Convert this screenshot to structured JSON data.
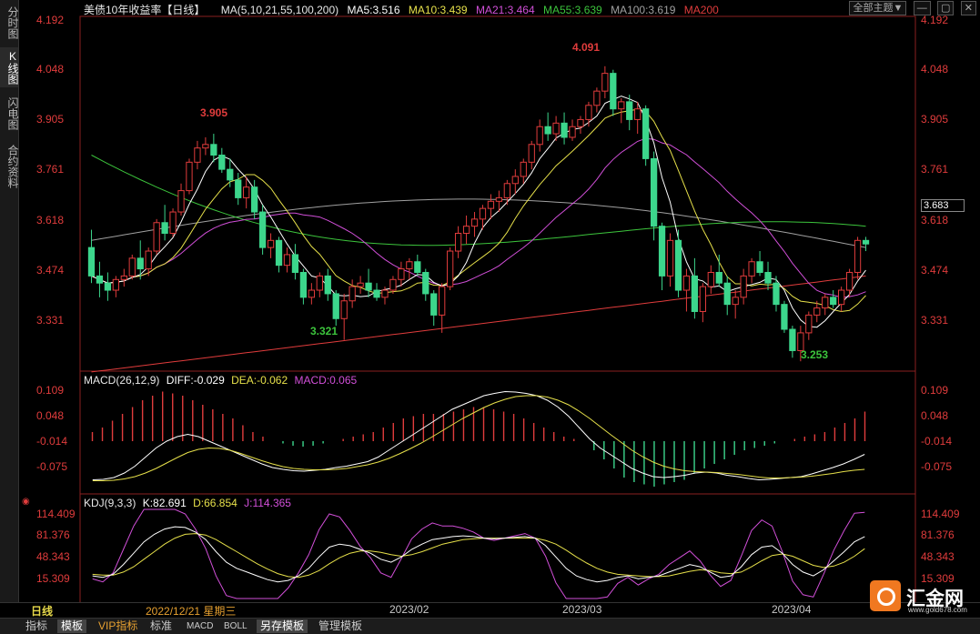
{
  "left_tabs": [
    {
      "label": "分时图",
      "active": false
    },
    {
      "label": "K线图",
      "active": true
    },
    {
      "label": "闪电图",
      "active": false
    },
    {
      "label": "合约资料",
      "active": false
    }
  ],
  "header": {
    "title": "美债10年收益率",
    "period": "【日线】",
    "ma_label": "MA(5,10,21,55,100,200)",
    "ma5": "MA5:3.516",
    "ma10": "MA10:3.439",
    "ma21": "MA21:3.464",
    "ma55": "MA55:3.639",
    "ma100": "MA100:3.619",
    "ma200": "MA200",
    "theme_btn": "全部主题▼",
    "colors": {
      "ma5": "#ffffff",
      "ma10": "#e6e04a",
      "ma21": "#d14fd8",
      "ma55": "#3cc43c",
      "ma100": "#a0a0a0",
      "ma200": "#e03c3c"
    }
  },
  "main_axis": {
    "ticks": [
      "4.192",
      "4.048",
      "3.905",
      "3.761",
      "3.618",
      "3.474",
      "3.331"
    ],
    "current_price": "3.683"
  },
  "annotations": {
    "high1": "3.905",
    "low1": "3.321",
    "high2": "4.091",
    "low2": "3.253"
  },
  "macd": {
    "title": "MACD(26,12,9)",
    "diff": "DIFF:-0.029",
    "dea": "DEA:-0.062",
    "macd": "MACD:0.065",
    "ticks": [
      "0.109",
      "0.048",
      "-0.014",
      "-0.075"
    ]
  },
  "kdj": {
    "title": "KDJ(9,3,3)",
    "k": "K:82.691",
    "d": "D:66.854",
    "j": "J:114.365",
    "ticks": [
      "114.409",
      "81.376",
      "48.343",
      "15.309"
    ]
  },
  "date_axis": {
    "period_label": "日线",
    "cursor_date": "2022/12/21 星期三",
    "months": [
      "2023/02",
      "2023/03",
      "2023/04"
    ]
  },
  "bottom_tabs": [
    {
      "label": "指标",
      "active": false
    },
    {
      "label": "模板",
      "active": true
    },
    {
      "label": "VIP指标",
      "active": false
    },
    {
      "label": "标准",
      "active": false
    },
    {
      "label": "MACD",
      "active": false
    },
    {
      "label": "BOLL",
      "active": false
    },
    {
      "label": "另存模板",
      "active": true
    },
    {
      "label": "管理模板",
      "active": false
    }
  ],
  "logo": {
    "text": "汇金网",
    "url": "www.gold678.com"
  },
  "chart_data": {
    "type": "candlestick",
    "ylim": [
      3.24,
      4.22
    ],
    "candles": [
      [
        3.58,
        3.63,
        3.48,
        3.5
      ],
      [
        3.5,
        3.54,
        3.44,
        3.48
      ],
      [
        3.48,
        3.51,
        3.43,
        3.46
      ],
      [
        3.46,
        3.5,
        3.44,
        3.49
      ],
      [
        3.49,
        3.52,
        3.47,
        3.5
      ],
      [
        3.5,
        3.56,
        3.49,
        3.55
      ],
      [
        3.55,
        3.6,
        3.49,
        3.52
      ],
      [
        3.52,
        3.58,
        3.5,
        3.57
      ],
      [
        3.57,
        3.66,
        3.56,
        3.65
      ],
      [
        3.65,
        3.7,
        3.6,
        3.62
      ],
      [
        3.62,
        3.69,
        3.61,
        3.68
      ],
      [
        3.68,
        3.76,
        3.67,
        3.74
      ],
      [
        3.74,
        3.83,
        3.73,
        3.82
      ],
      [
        3.82,
        3.88,
        3.8,
        3.86
      ],
      [
        3.86,
        3.89,
        3.84,
        3.87
      ],
      [
        3.87,
        3.9,
        3.82,
        3.84
      ],
      [
        3.84,
        3.86,
        3.79,
        3.8
      ],
      [
        3.8,
        3.83,
        3.75,
        3.77
      ],
      [
        3.77,
        3.79,
        3.7,
        3.72
      ],
      [
        3.72,
        3.78,
        3.69,
        3.75
      ],
      [
        3.75,
        3.77,
        3.66,
        3.68
      ],
      [
        3.68,
        3.7,
        3.56,
        3.58
      ],
      [
        3.58,
        3.62,
        3.55,
        3.6
      ],
      [
        3.6,
        3.61,
        3.51,
        3.53
      ],
      [
        3.53,
        3.58,
        3.51,
        3.56
      ],
      [
        3.56,
        3.59,
        3.49,
        3.51
      ],
      [
        3.51,
        3.52,
        3.42,
        3.44
      ],
      [
        3.44,
        3.48,
        3.42,
        3.46
      ],
      [
        3.46,
        3.51,
        3.44,
        3.5
      ],
      [
        3.5,
        3.52,
        3.43,
        3.45
      ],
      [
        3.45,
        3.46,
        3.36,
        3.38
      ],
      [
        3.38,
        3.45,
        3.32,
        3.43
      ],
      [
        3.43,
        3.49,
        3.41,
        3.47
      ],
      [
        3.47,
        3.5,
        3.45,
        3.48
      ],
      [
        3.48,
        3.52,
        3.44,
        3.46
      ],
      [
        3.46,
        3.48,
        3.43,
        3.44
      ],
      [
        3.44,
        3.47,
        3.42,
        3.46
      ],
      [
        3.46,
        3.5,
        3.45,
        3.49
      ],
      [
        3.49,
        3.54,
        3.47,
        3.52
      ],
      [
        3.52,
        3.55,
        3.49,
        3.54
      ],
      [
        3.54,
        3.56,
        3.5,
        3.51
      ],
      [
        3.51,
        3.52,
        3.43,
        3.45
      ],
      [
        3.45,
        3.46,
        3.36,
        3.39
      ],
      [
        3.39,
        3.48,
        3.34,
        3.47
      ],
      [
        3.47,
        3.58,
        3.46,
        3.57
      ],
      [
        3.57,
        3.64,
        3.55,
        3.62
      ],
      [
        3.62,
        3.67,
        3.59,
        3.64
      ],
      [
        3.64,
        3.68,
        3.61,
        3.66
      ],
      [
        3.66,
        3.7,
        3.63,
        3.69
      ],
      [
        3.69,
        3.73,
        3.66,
        3.71
      ],
      [
        3.71,
        3.74,
        3.68,
        3.72
      ],
      [
        3.72,
        3.77,
        3.7,
        3.76
      ],
      [
        3.76,
        3.8,
        3.73,
        3.78
      ],
      [
        3.78,
        3.83,
        3.76,
        3.82
      ],
      [
        3.82,
        3.88,
        3.8,
        3.87
      ],
      [
        3.87,
        3.94,
        3.85,
        3.92
      ],
      [
        3.92,
        3.96,
        3.88,
        3.9
      ],
      [
        3.9,
        3.95,
        3.88,
        3.93
      ],
      [
        3.93,
        3.96,
        3.87,
        3.89
      ],
      [
        3.89,
        3.94,
        3.88,
        3.92
      ],
      [
        3.92,
        3.95,
        3.9,
        3.94
      ],
      [
        3.94,
        3.99,
        3.92,
        3.98
      ],
      [
        3.98,
        4.03,
        3.96,
        4.02
      ],
      [
        4.02,
        4.09,
        4.0,
        4.07
      ],
      [
        4.07,
        4.08,
        3.95,
        3.97
      ],
      [
        3.97,
        4.0,
        3.93,
        3.99
      ],
      [
        3.99,
        4.01,
        3.91,
        3.94
      ],
      [
        3.94,
        3.99,
        3.9,
        3.97
      ],
      [
        3.97,
        3.98,
        3.81,
        3.83
      ],
      [
        3.83,
        3.85,
        3.6,
        3.64
      ],
      [
        3.64,
        3.65,
        3.46,
        3.5
      ],
      [
        3.5,
        3.62,
        3.47,
        3.6
      ],
      [
        3.6,
        3.63,
        3.44,
        3.46
      ],
      [
        3.46,
        3.52,
        3.4,
        3.5
      ],
      [
        3.5,
        3.55,
        3.38,
        3.4
      ],
      [
        3.4,
        3.48,
        3.37,
        3.47
      ],
      [
        3.47,
        3.53,
        3.45,
        3.51
      ],
      [
        3.51,
        3.56,
        3.47,
        3.48
      ],
      [
        3.48,
        3.5,
        3.39,
        3.42
      ],
      [
        3.42,
        3.46,
        3.38,
        3.44
      ],
      [
        3.44,
        3.52,
        3.42,
        3.5
      ],
      [
        3.5,
        3.55,
        3.48,
        3.54
      ],
      [
        3.54,
        3.57,
        3.5,
        3.51
      ],
      [
        3.51,
        3.54,
        3.46,
        3.48
      ],
      [
        3.48,
        3.5,
        3.4,
        3.42
      ],
      [
        3.42,
        3.43,
        3.34,
        3.35
      ],
      [
        3.35,
        3.36,
        3.27,
        3.29
      ],
      [
        3.29,
        3.36,
        3.26,
        3.34
      ],
      [
        3.34,
        3.4,
        3.32,
        3.39
      ],
      [
        3.39,
        3.43,
        3.37,
        3.41
      ],
      [
        3.41,
        3.45,
        3.39,
        3.44
      ],
      [
        3.44,
        3.46,
        3.41,
        3.42
      ],
      [
        3.42,
        3.47,
        3.4,
        3.46
      ],
      [
        3.46,
        3.52,
        3.44,
        3.51
      ],
      [
        3.51,
        3.61,
        3.49,
        3.6
      ],
      [
        3.6,
        3.61,
        3.57,
        3.59
      ]
    ],
    "macd_hist": [
      0.02,
      0.03,
      0.045,
      0.06,
      0.075,
      0.09,
      0.1,
      0.109,
      0.105,
      0.1,
      0.09,
      0.08,
      0.07,
      0.06,
      0.05,
      0.035,
      0.02,
      0.01,
      0.0,
      -0.005,
      -0.01,
      -0.012,
      -0.01,
      -0.005,
      0.0,
      0.005,
      0.01,
      0.015,
      0.02,
      0.03,
      0.04,
      0.05,
      0.055,
      0.06,
      0.06,
      0.06,
      0.065,
      0.07,
      0.075,
      0.075,
      0.07,
      0.065,
      0.06,
      0.05,
      0.04,
      0.03,
      0.02,
      0.01,
      0.005,
      0.0,
      -0.02,
      -0.04,
      -0.06,
      -0.08,
      -0.09,
      -0.095,
      -0.1,
      -0.095,
      -0.09,
      -0.085,
      -0.07,
      -0.06,
      -0.05,
      -0.04,
      -0.03,
      -0.02,
      -0.015,
      -0.01,
      -0.005,
      0.0,
      0.005,
      0.01,
      0.015,
      0.02,
      0.03,
      0.04,
      0.05,
      0.065
    ],
    "macd_diff": [
      -0.085,
      -0.084,
      -0.08,
      -0.07,
      -0.055,
      -0.035,
      -0.015,
      0.0,
      0.01,
      0.015,
      0.01,
      0.0,
      -0.01,
      -0.02,
      -0.03,
      -0.04,
      -0.05,
      -0.058,
      -0.062,
      -0.065,
      -0.066,
      -0.064,
      -0.062,
      -0.058,
      -0.055,
      -0.05,
      -0.045,
      -0.035,
      -0.02,
      -0.005,
      0.01,
      0.025,
      0.04,
      0.055,
      0.07,
      0.08,
      0.09,
      0.1,
      0.105,
      0.109,
      0.108,
      0.105,
      0.1,
      0.09,
      0.075,
      0.055,
      0.03,
      0.005,
      -0.015,
      -0.03,
      -0.045,
      -0.06,
      -0.07,
      -0.078,
      -0.08,
      -0.078,
      -0.075,
      -0.07,
      -0.068,
      -0.07,
      -0.075,
      -0.078,
      -0.082,
      -0.085,
      -0.084,
      -0.082,
      -0.08,
      -0.078,
      -0.072,
      -0.065,
      -0.058,
      -0.05,
      -0.04,
      -0.029
    ],
    "macd_dea": [
      -0.087,
      -0.087,
      -0.086,
      -0.083,
      -0.078,
      -0.07,
      -0.06,
      -0.048,
      -0.036,
      -0.025,
      -0.018,
      -0.015,
      -0.016,
      -0.02,
      -0.027,
      -0.035,
      -0.043,
      -0.05,
      -0.056,
      -0.06,
      -0.062,
      -0.063,
      -0.063,
      -0.062,
      -0.06,
      -0.056,
      -0.052,
      -0.046,
      -0.038,
      -0.028,
      -0.017,
      -0.005,
      0.008,
      0.022,
      0.036,
      0.05,
      0.062,
      0.074,
      0.084,
      0.092,
      0.098,
      0.1,
      0.1,
      0.097,
      0.09,
      0.08,
      0.066,
      0.05,
      0.032,
      0.014,
      -0.003,
      -0.02,
      -0.034,
      -0.046,
      -0.055,
      -0.061,
      -0.065,
      -0.067,
      -0.068,
      -0.069,
      -0.071,
      -0.073,
      -0.076,
      -0.079,
      -0.081,
      -0.081,
      -0.08,
      -0.079,
      -0.077,
      -0.074,
      -0.071,
      -0.067,
      -0.064,
      -0.062
    ],
    "kdj_k": [
      30,
      28,
      32,
      45,
      60,
      75,
      85,
      92,
      95,
      94,
      88,
      78,
      62,
      48,
      40,
      35,
      30,
      25,
      22,
      24,
      30,
      40,
      55,
      68,
      72,
      70,
      65,
      60,
      52,
      48,
      55,
      65,
      72,
      78,
      80,
      82,
      83,
      82,
      80,
      79,
      80,
      81,
      82,
      80,
      70,
      55,
      40,
      30,
      25,
      22,
      24,
      28,
      30,
      26,
      28,
      30,
      35,
      40,
      45,
      42,
      35,
      28,
      30,
      42,
      58,
      68,
      70,
      60,
      45,
      35,
      30,
      38,
      50,
      62,
      75,
      82
    ],
    "kdj_d": [
      32,
      31,
      31,
      35,
      42,
      52,
      62,
      72,
      80,
      85,
      86,
      84,
      78,
      70,
      62,
      54,
      46,
      39,
      33,
      29,
      28,
      31,
      37,
      46,
      54,
      60,
      63,
      63,
      61,
      58,
      56,
      58,
      62,
      67,
      72,
      75,
      78,
      79,
      80,
      80,
      80,
      80,
      80,
      80,
      77,
      72,
      64,
      55,
      47,
      40,
      35,
      32,
      31,
      30,
      29,
      29,
      30,
      33,
      36,
      38,
      37,
      34,
      33,
      35,
      42,
      50,
      57,
      59,
      56,
      50,
      44,
      41,
      43,
      48,
      56,
      66
    ]
  }
}
